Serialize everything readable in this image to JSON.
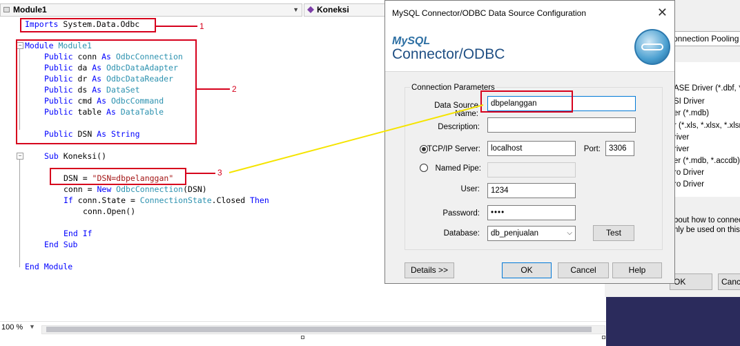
{
  "editor": {
    "module_dropdown": "Module1",
    "method_dropdown": "Koneksi",
    "code": {
      "imports_kw": "Imports",
      "imports_ns": " System.Data.Odbc",
      "module_kw": "Module",
      "module_name": " Module1",
      "public": "Public",
      "as": "As",
      "decls": [
        {
          "name": " conn ",
          "type": " OdbcConnection"
        },
        {
          "name": " da ",
          "type": " OdbcDataAdapter"
        },
        {
          "name": " dr ",
          "type": " OdbcDataReader"
        },
        {
          "name": " ds ",
          "type": " DataSet"
        },
        {
          "name": " cmd ",
          "type": " OdbcCommand"
        },
        {
          "name": " table ",
          "type": " DataTable"
        }
      ],
      "dsn_decl_name": " DSN ",
      "dsn_decl_type": " String",
      "sub_kw": "Sub",
      "sub_name": " Koneksi()",
      "dsn_assign": "DSN = ",
      "dsn_value": "\"DSN=dbpelanggan\"",
      "conn_assign": "conn = ",
      "new_kw": "New",
      "conn_new": " OdbcConnection",
      "conn_args": "(DSN)",
      "if_kw": "If",
      "if_cond": " conn.State = ",
      "state_type": "ConnectionState",
      "state_closed": ".Closed ",
      "then_kw": "Then",
      "open_call": "conn.Open()",
      "end_if": "End If",
      "end_sub": "End Sub",
      "end_module": "End Module"
    },
    "annotations": [
      "1",
      "2",
      "3"
    ],
    "zoom": "100 %"
  },
  "background_window": {
    "tab_label": "onnection Pooling",
    "drivers": [
      "ASE Driver (*.dbf, *.n",
      "SI Driver",
      "er (*.mdb)",
      "r (*.xls, *.xlsx, *.xlsm,",
      "river",
      "river",
      "er (*.mdb, *.accdb)",
      "ro Driver",
      "ro Driver"
    ],
    "info_lines": [
      "bout how to connect",
      "nly be used on this c"
    ],
    "ok_button": "OK",
    "cancel_button": "Cance"
  },
  "dialog": {
    "title": "MySQL Connector/ODBC Data Source Configuration",
    "logo_top": "MySQL",
    "logo_bottom": "Connector/ODBC",
    "group_label": "Connection Parameters",
    "labels": {
      "dsn": "Data Source Name:",
      "description": "Description:",
      "tcp": "TCP/IP Server:",
      "port": "Port:",
      "pipe": "Named Pipe:",
      "user": "User:",
      "password": "Password:",
      "database": "Database:"
    },
    "values": {
      "dsn": "dbpelanggan",
      "description": "",
      "tcp": "localhost",
      "port": "3306",
      "pipe": "",
      "user": "1234",
      "password": "••••",
      "database": "db_penjualan"
    },
    "selected_connection": "TCP/IP Server",
    "buttons": {
      "test": "Test",
      "details": "Details >>",
      "ok": "OK",
      "cancel": "Cancel",
      "help": "Help"
    }
  },
  "colors": {
    "keyword": "#0000ff",
    "type": "#2b91af",
    "string": "#a31515",
    "annotation_red": "#d6001c",
    "annotation_yellow": "#f5e400"
  }
}
